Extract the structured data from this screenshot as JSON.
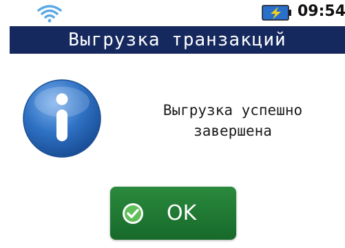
{
  "status_bar": {
    "wifi_icon": "wifi-icon",
    "battery_icon": "battery-charging-icon",
    "time": "09:54"
  },
  "title_bar": {
    "title": "Выгрузка транзакций"
  },
  "dialog": {
    "icon": "info-icon",
    "message_line1": "Выгрузка успешно",
    "message_line2": "завершена"
  },
  "ok_button": {
    "icon": "check-icon",
    "label": "OK"
  },
  "colors": {
    "title_bar_bg": "#16295f",
    "button_green": "#1f7a33",
    "info_blue": "#2f72c4",
    "battery_yellow": "#f2d21b",
    "battery_blue": "#2a6fc9"
  }
}
